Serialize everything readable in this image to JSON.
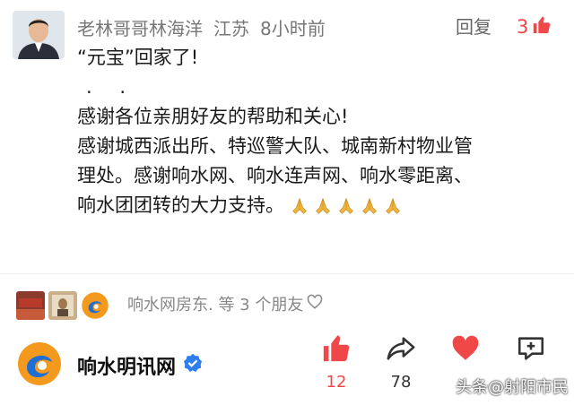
{
  "comment": {
    "author": "老林哥哥林海洋",
    "location": "江苏",
    "time_ago": "8小时前",
    "reply_label": "回复",
    "like_count": "3",
    "content": {
      "line1": "“元宝”回家了!",
      "line2": ". .",
      "line3": "感谢各位亲朋好友的帮助和关心!",
      "line4": "感谢城西派出所、特巡警大队、城南新村物业管",
      "line5": "理处。感谢响水网、响水连声网、响水零距离、",
      "line6": "响水团团转的大力支持。"
    }
  },
  "likers": {
    "text": "响水网房东. 等 3 个朋友"
  },
  "account": {
    "name": "响水明讯网",
    "verified_icon": "verified-badge-icon"
  },
  "actions": {
    "like_count": "12",
    "share_count": "78"
  },
  "watermark": "头条@射阳市民",
  "colors": {
    "accent_red": "#f04848",
    "verified_blue": "#2d7ff0",
    "logo_orange": "#f39a1e",
    "logo_blue": "#1f6fd2"
  }
}
